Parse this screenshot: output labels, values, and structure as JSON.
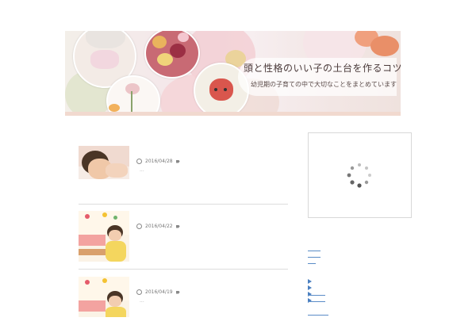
{
  "header": {
    "title": "頭と性格のいい子の土台を作るコツ",
    "subtitle": "幼児期の子育ての中で大切なことをまとめています"
  },
  "posts": [
    {
      "date": "2016/04/28",
      "excerpt": "..."
    },
    {
      "date": "2016/04/22",
      "excerpt": ""
    },
    {
      "date": "2016/04/19",
      "excerpt": "..."
    }
  ],
  "colors": {
    "accent": "#4a7fc0",
    "divider": "#dddddd",
    "banner_strip": "#f1d9cf"
  },
  "icons": [
    "clock-icon",
    "tag-icon",
    "loading-spinner-icon",
    "arrow-right-icon"
  ]
}
